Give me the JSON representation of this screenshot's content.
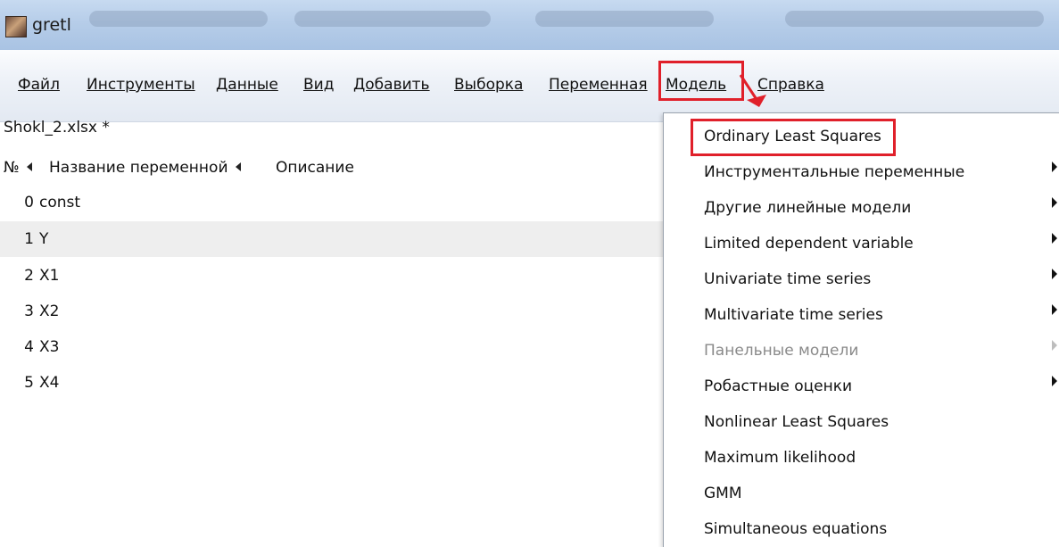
{
  "window": {
    "title": "gretl"
  },
  "menubar": {
    "items": [
      "Файл",
      "Инструменты",
      "Данные",
      "Вид",
      "Добавить",
      "Выборка",
      "Переменная",
      "Модель",
      "Справка"
    ]
  },
  "panel": {
    "title": "Shokl_2.xlsx *",
    "columns": {
      "number": "№",
      "name": "Название переменной",
      "description": "Описание"
    },
    "rows": [
      {
        "num": "0",
        "name": "const"
      },
      {
        "num": "1",
        "name": "Y"
      },
      {
        "num": "2",
        "name": "X1"
      },
      {
        "num": "3",
        "name": "X2"
      },
      {
        "num": "4",
        "name": "X3"
      },
      {
        "num": "5",
        "name": "X4"
      }
    ]
  },
  "model_menu": {
    "items": [
      {
        "label": "Ordinary Least Squares",
        "submenu": false,
        "disabled": false
      },
      {
        "label": "Инструментальные переменные",
        "submenu": true,
        "disabled": false
      },
      {
        "label": "Другие линейные модели",
        "submenu": true,
        "disabled": false
      },
      {
        "label": "Limited dependent variable",
        "submenu": true,
        "disabled": false
      },
      {
        "label": "Univariate time series",
        "submenu": true,
        "disabled": false
      },
      {
        "label": "Multivariate time series",
        "submenu": true,
        "disabled": false
      },
      {
        "label": "Панельные модели",
        "submenu": true,
        "disabled": true
      },
      {
        "label": "Робастные оценки",
        "submenu": true,
        "disabled": false
      },
      {
        "label": "Nonlinear Least Squares",
        "submenu": false,
        "disabled": false
      },
      {
        "label": "Maximum likelihood",
        "submenu": false,
        "disabled": false
      },
      {
        "label": "GMM",
        "submenu": false,
        "disabled": false
      },
      {
        "label": "Simultaneous equations",
        "submenu": false,
        "disabled": false
      }
    ]
  },
  "colors": {
    "highlight": "#e0202a",
    "selected_row": "#eeeeee",
    "disabled_text": "#8a8a8a"
  }
}
